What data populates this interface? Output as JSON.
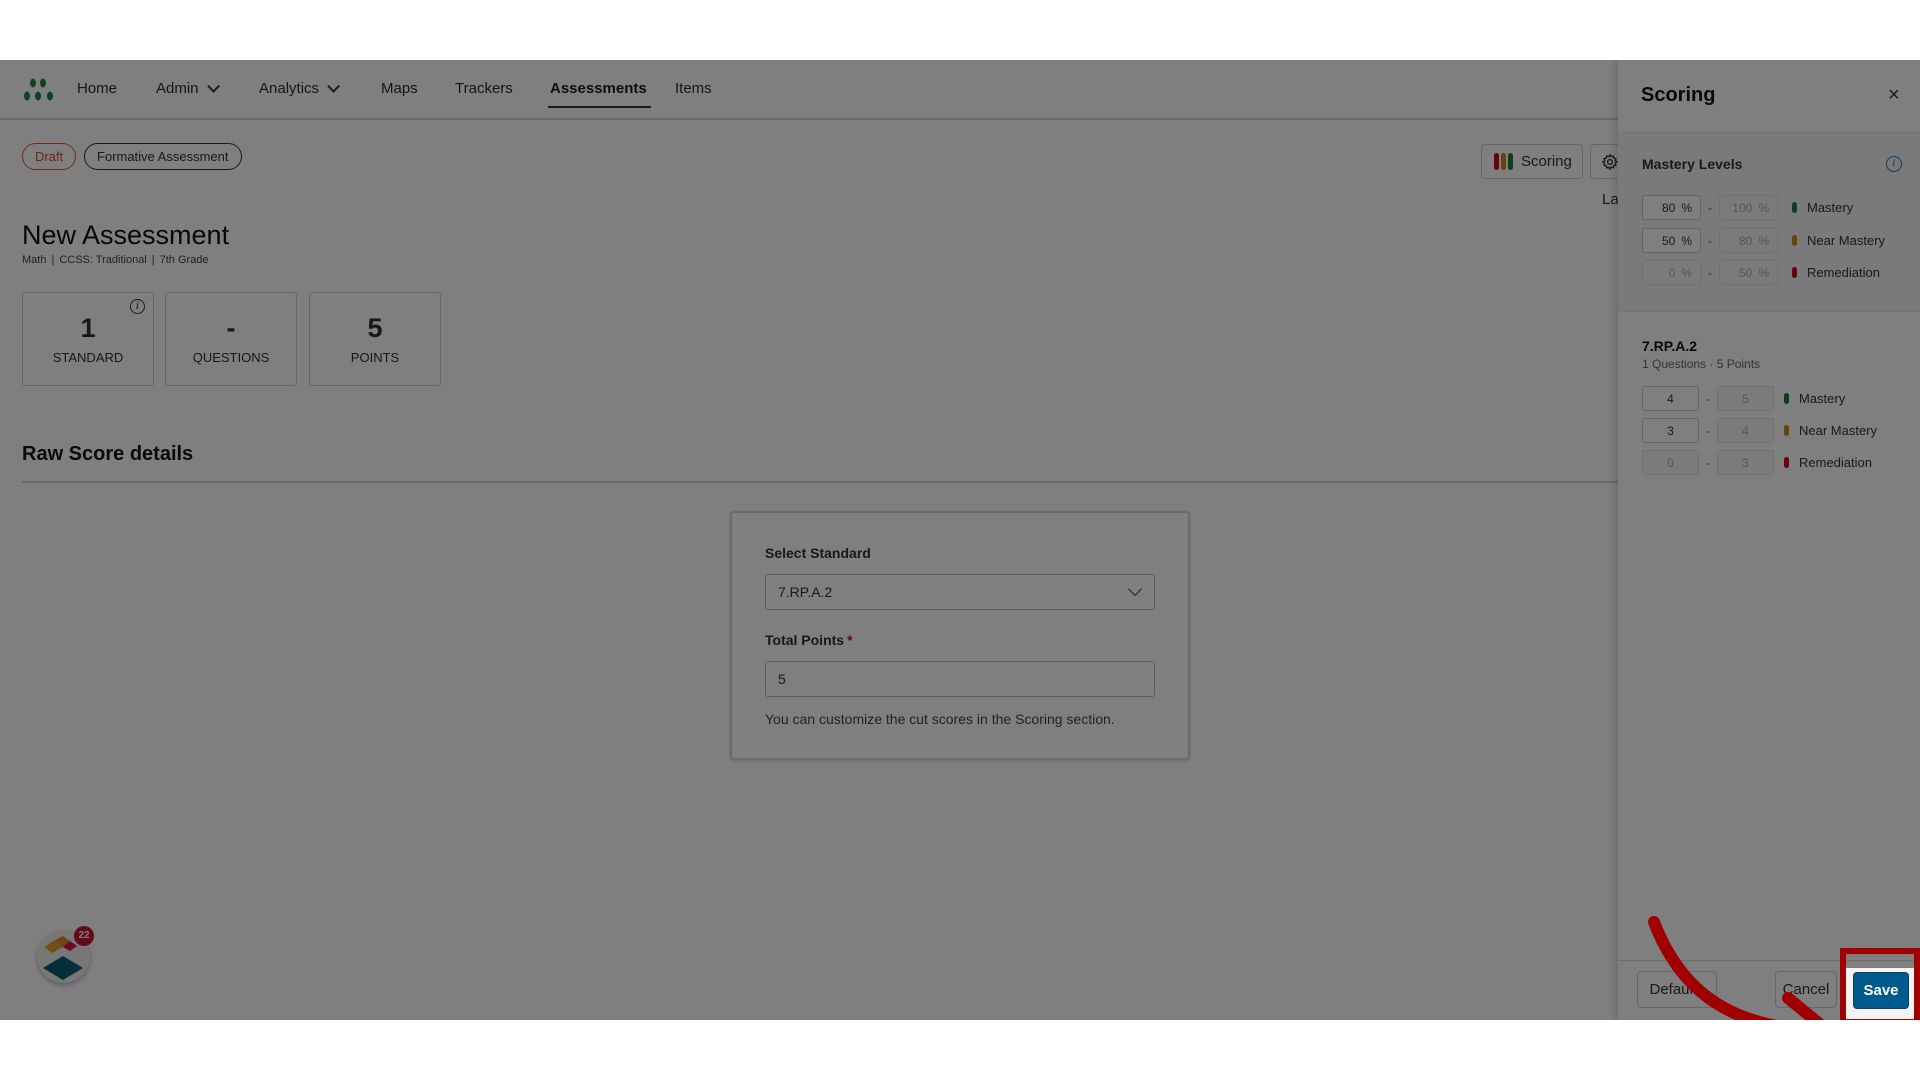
{
  "nav": {
    "items": [
      {
        "label": "Home",
        "dropdown": false,
        "active": false
      },
      {
        "label": "Admin",
        "dropdown": true,
        "active": false
      },
      {
        "label": "Analytics",
        "dropdown": true,
        "active": false
      },
      {
        "label": "Maps",
        "dropdown": false,
        "active": false
      },
      {
        "label": "Trackers",
        "dropdown": false,
        "active": false
      },
      {
        "label": "Assessments",
        "dropdown": false,
        "active": true
      },
      {
        "label": "Items",
        "dropdown": false,
        "active": false
      }
    ]
  },
  "tags": {
    "status": "Draft",
    "type": "Formative Assessment"
  },
  "header_actions": {
    "scoring_label": "Scoring",
    "settings_icon": "gear-icon",
    "truncated_text": "La"
  },
  "assessment": {
    "title": "New Assessment",
    "meta": [
      "Math",
      "CCSS: Traditional",
      "7th Grade"
    ]
  },
  "stats": [
    {
      "value": "1",
      "label": "STANDARD",
      "has_info": true
    },
    {
      "value": "-",
      "label": "QUESTIONS",
      "has_info": false
    },
    {
      "value": "5",
      "label": "POINTS",
      "has_info": false
    }
  ],
  "raw_score": {
    "section_title": "Raw Score details",
    "select_label": "Select Standard",
    "select_value": "7.RP.A.2",
    "points_label": "Total Points",
    "points_required_mark": "*",
    "points_value": "5",
    "hint": "You can customize the cut scores in the Scoring section."
  },
  "widget": {
    "badge_count": "22"
  },
  "scoring_panel": {
    "title": "Scoring",
    "close_icon": "×",
    "mastery_levels": {
      "title": "Mastery Levels",
      "rows": [
        {
          "from": "80",
          "to": "100",
          "unit": "%",
          "label": "Mastery",
          "color": "#1a7f37",
          "from_editable": true
        },
        {
          "from": "50",
          "to": "80",
          "unit": "%",
          "label": "Near Mastery",
          "color": "#c98a1c",
          "from_editable": true
        },
        {
          "from": "0",
          "to": "50",
          "unit": "%",
          "label": "Remediation",
          "color": "#d0021b",
          "from_editable": false
        }
      ]
    },
    "standard": {
      "code": "7.RP.A.2",
      "summary": "1 Questions · 5 Points",
      "rows": [
        {
          "from": "4",
          "to": "5",
          "label": "Mastery",
          "color": "#1a7f37",
          "from_editable": true
        },
        {
          "from": "3",
          "to": "4",
          "label": "Near Mastery",
          "color": "#c98a1c",
          "from_editable": true
        },
        {
          "from": "0",
          "to": "3",
          "label": "Remediation",
          "color": "#d0021b",
          "from_editable": false
        }
      ]
    },
    "footer": {
      "defaults_label": "Defaults",
      "cancel_label": "Cancel",
      "save_label": "Save"
    }
  },
  "colors": {
    "accent": "#005a8c",
    "draft": "#e04d1c",
    "highlight": "#a00000"
  }
}
